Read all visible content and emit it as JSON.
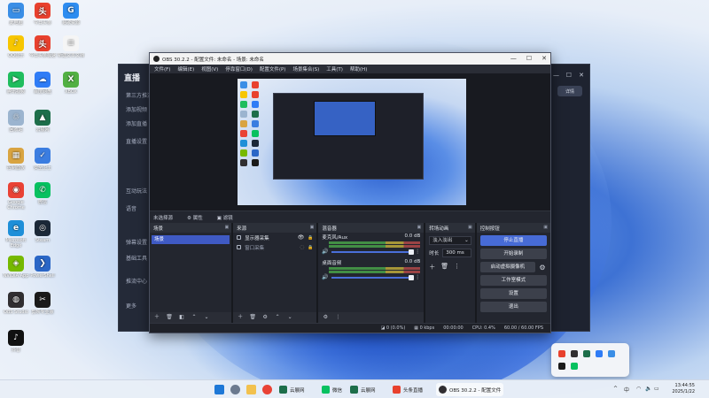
{
  "desktop": {
    "icons": [
      {
        "label": "此电脑",
        "color": "#3a8ee6",
        "glyph": "▭"
      },
      {
        "label": "今日头条",
        "color": "#e8412e",
        "glyph": "头"
      },
      {
        "label": "易歌资源",
        "color": "#2d8cf0",
        "glyph": "G"
      },
      {
        "label": "QQ音乐",
        "color": "#f7c600",
        "glyph": "♪"
      },
      {
        "label": "今日头条极速",
        "color": "#e8412e",
        "glyph": "头"
      },
      {
        "label": "新建文本文档",
        "color": "#f5f5f5",
        "glyph": "≡"
      },
      {
        "label": "腾讯视频",
        "color": "#1fbd5e",
        "glyph": "▶"
      },
      {
        "label": "百度网盘",
        "color": "#2f7cf6",
        "glyph": "☁"
      },
      {
        "label": "XBOX",
        "color": "#52b043",
        "glyph": "X"
      },
      {
        "label": "回收站",
        "color": "#9bb4cf",
        "glyph": "♲"
      },
      {
        "label": "云展网",
        "color": "#1d6e4a",
        "glyph": "▲"
      },
      {
        "label": "控制面板",
        "color": "#d9a441",
        "glyph": "▦"
      },
      {
        "label": "安全卫士",
        "color": "#3b7de0",
        "glyph": "✓"
      },
      {
        "label": "Google Chrome",
        "color": "#e94235",
        "glyph": "◉"
      },
      {
        "label": "微信",
        "color": "#07c160",
        "glyph": "✆"
      },
      {
        "label": "Microsoft Edge",
        "color": "#1e8fd8",
        "glyph": "e"
      },
      {
        "label": "Steam",
        "color": "#1b2838",
        "glyph": "◎"
      },
      {
        "label": "NVIDIA App",
        "color": "#76b900",
        "glyph": "◈"
      },
      {
        "label": "PowerShell",
        "color": "#2a66c6",
        "glyph": "❯"
      },
      {
        "label": "OBS Studio",
        "color": "#302e31",
        "glyph": "◍"
      },
      {
        "label": "剪映专业版",
        "color": "#1a1a1a",
        "glyph": "✂"
      },
      {
        "label": "抖音",
        "color": "#111111",
        "glyph": "♪"
      }
    ]
  },
  "back_app": {
    "logo": "直播",
    "sidebar_items": [
      "第三方推流",
      "添加视频",
      "添加直播",
      "直播设置",
      "互动玩法",
      "语音",
      "弹幕设置",
      "基础工具",
      "推流中心",
      "更多"
    ],
    "right_button": "详情",
    "win_controls": [
      "—",
      "☐",
      "✕"
    ]
  },
  "obs": {
    "title": "OBS 30.2.2 - 配置文件: 未命名 - 场景: 未命名",
    "win_controls": [
      "—",
      "☐",
      "✕"
    ],
    "menu": [
      "文件(F)",
      "编辑(E)",
      "视图(V)",
      "停靠窗口(D)",
      "配置文件(P)",
      "场景集合(S)",
      "工具(T)",
      "帮助(H)"
    ],
    "dock_strip": {
      "no_source": "未选择源",
      "properties": "属性",
      "filters": "滤镜"
    },
    "scenes": {
      "title": "场景",
      "items": [
        "场景"
      ]
    },
    "sources": {
      "title": "来源",
      "items": [
        {
          "label": "显示器采集"
        },
        {
          "label": "窗口采集"
        }
      ]
    },
    "mixer": {
      "title": "混音器",
      "channels": [
        {
          "name": "麦克风/Aux",
          "db": "0.0 dB"
        },
        {
          "name": "桌面音频",
          "db": "0.0 dB"
        }
      ]
    },
    "transitions": {
      "title": "转场动画",
      "type": "淡入淡出",
      "duration_label": "时长",
      "duration_value": "300 ms"
    },
    "controls": {
      "title": "控制按钮",
      "start_stream": "停止直播",
      "start_record": "开始录制",
      "virtual_cam": "启动虚拟摄像机",
      "studio_mode": "工作室模式",
      "settings": "设置",
      "exit": "退出"
    },
    "status": {
      "dropped": "0 (0.0%)",
      "bitrate": "0 kbps",
      "time": "00:00:00",
      "cpu": "CPU: 0.4%",
      "fps": "60.00 / 60.00 FPS"
    }
  },
  "taskbar": {
    "apps": [
      {
        "label": "云展网",
        "color": "#1d6e4a"
      },
      {
        "label": "微信",
        "color": "#07c160"
      },
      {
        "label": "云展网",
        "color": "#1d6e4a"
      },
      {
        "label": "头条直播",
        "color": "#e8412e"
      },
      {
        "label": "OBS 30.2.2 - 配置文件",
        "color": "#302e31"
      }
    ],
    "tray": [
      "^",
      "中"
    ],
    "time": "13:44:55",
    "date": "2025/1/22"
  }
}
